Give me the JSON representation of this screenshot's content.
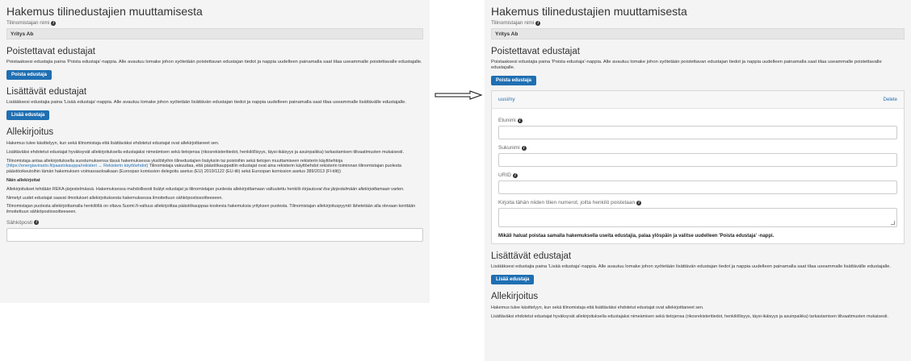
{
  "left": {
    "title": "Hakemus tilinedustajien muuttamisesta",
    "account_owner_label": "Tilinomistajan nimi",
    "account_owner_value": "Yritys Ab",
    "remove_heading": "Poistettavat edustajat",
    "remove_desc": "Poistaaksesi edustajia paina 'Poista edustaja'-nappia. Alle avautuu lomake johon syötetään poistettavan edustajan tiedot ja nappia uudelleen painamalla saat tilaa useammalle poistettavalle edustajalle.",
    "remove_button": "Poista edustaja",
    "add_heading": "Lisättävät edustajat",
    "add_desc": "Lisätäksesi edustajia paina 'Lisää edustaja'-nappia. Alle avautuu lomake johon syötetään lisättävän edustajan tiedot ja nappia uudelleen painamalla saat tilaa useammalle lisättävälle edustajalle.",
    "add_button": "Lisää edustaja",
    "sign_heading": "Allekirjoitus",
    "sign_p1": "Hakemus tulee käsittelyyn, kun sekä tilinomistaja että lisättäväksi ehdotetut edustajat ovat allekirjoittaneet sen.",
    "sign_p2": "Lisättäväksi ehdotetut edustajat hyväksyvät allekirjoituksella edustajaksi nimeämisen sekä tietojensa (rikosrekisteritiedot, henkilöllisyys, täysi-ikäisyys ja asuinpaikka) tarkastamisen tilivaatimusten mukaisesti.",
    "sign_p3a": "Tilinomistaja antaa allekirjoituksella suostumuksensa tässä hakemuksessa yksilöityihin tilinedustajien lisäyksiin tai poistoihin sekä tietojen muuttamiseen rekisterin käyttöehtoja",
    "sign_p3_link": "(https://energiavirasto.fi/paastokauppa/rekisteri → Rekisterin käyttöehdot)",
    "sign_p3b": "Tilinomistaja vakuuttaa, että päästökauppatilin edustajat ovat aina rekisterin käyttöehdot rekisterin toiminnan tilinomistajan puolesta päästöoikeutoihin tämän hakemuksen voimassaoloaikaan (Euroopan komission delegoitu asetus (EU) 2019/1122 (EU-tili) sekä Euroopan komission asetus 389/2013 (FI-tilit))",
    "sign_sub": "Näin allekirjoitat",
    "sign_p4a": "Allekirjoitukset tehdään REKA-järjestelmässä. Hakemuksessa mahdollisesti lisätyt edustajat ja tilinomistajan puolesta allekirjoittamaan valtuutettu henkilö",
    "sign_p4_italic": "kirjautuvat itse järjestelmään allekirjoittamaan",
    "sign_p4b": "varten.",
    "sign_p5": "Nimetyt uudet edustajat saavat ilmoitukset allekirjoituksesta hakemuksessa ilmoitettuun sähköpostiosoitteeseen.",
    "sign_p6": "Tilinomistajan puolesta allekirjoittamalla henkilöllä on oltava Suomi.fi-valtuus allekirjoittaa päästökauppaa koskevia hakemuksia yrityksen puolesta. Tilinomistajan allekirjoituspyyntö lähetetään alla olevaan kenttään ilmoitettuun sähköpostiosoitteeseen.",
    "email_label": "Sähköposti"
  },
  "right": {
    "title": "Hakemus tilinedustajien muuttamisesta",
    "account_owner_label": "Tilinomistajan nimi",
    "account_owner_value": "Yritys Ab",
    "remove_heading": "Poistettavat edustajat",
    "remove_desc": "Poistaaksesi edustajia paina 'Poista edustaja'-nappia. Alle avautuu lomake johon syötetään poistettavan edustajan tiedot ja nappia uudelleen painamalla saat tilaa useammalle poistettavalle edustajalle.",
    "remove_button": "Poista edustaja",
    "card_title": "uusi/ny",
    "card_delete": "Delete",
    "firstname_label": "Etunimi",
    "lastname_label": "Sukunimi",
    "urid_label": "URID",
    "accounts_label": "Kirjoita tähän niiden tilien numerot, joilta henkilö poistetaan",
    "card_note": "Mikäli haluat poistaa samalla hakemuksella useita edustajia, palaa ylöspäin ja valitse uudelleen 'Poista edustaja' -nappi.",
    "add_heading": "Lisättävät edustajat",
    "add_desc": "Lisätäksesi edustajia paina 'Lisää edustaja'-nappia. Alle avautuu lomake johon syötetään lisättävän edustajan tiedot ja nappia uudelleen painamalla saat tilaa useammalle lisättävälle edustajalle.",
    "add_button": "Lisää edustaja",
    "sign_heading": "Allekirjoitus",
    "sign_p1": "Hakemus tulee käsittelyyn, kun sekä tilinomistaja että lisättäväksi ehdotetut edustajat ovat allekirjoittaneet sen.",
    "sign_p2": "Lisättäväksi ehdotetut edustajat hyväksyvät allekirjoituksella edustajaksi nimeämisen sekä tietojensa (rikosrekisteritiedot, henkilöllisyys, täysi-ikäisyys ja asuinpaikka) tarkastamisen tilivaatimusten mukaisesti."
  },
  "colors": {
    "accent": "#1f6fb2",
    "panel_bg": "#f4f4f4"
  },
  "icons": {
    "info": "info-icon",
    "arrow": "right-arrow-icon"
  }
}
